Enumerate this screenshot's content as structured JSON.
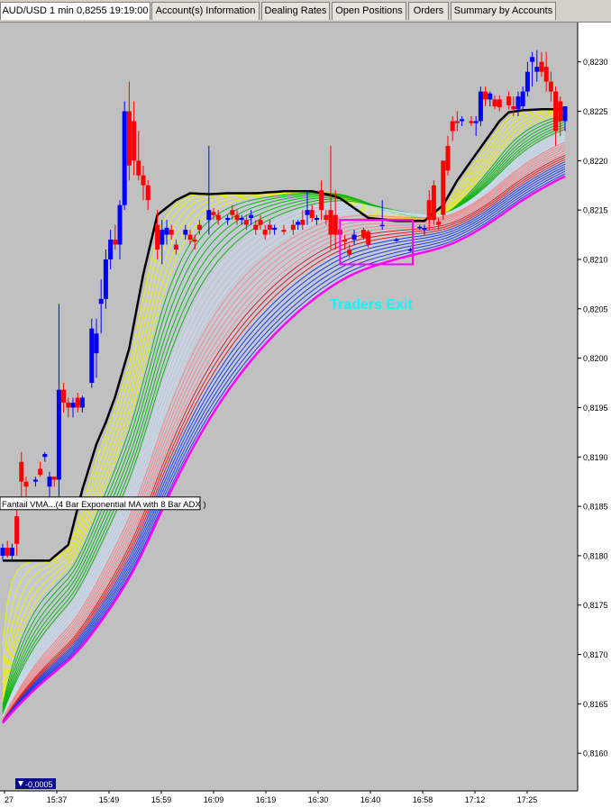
{
  "tabs": [
    {
      "label": "AUD/USD 1 min 0,8255 19:19:00"
    },
    {
      "label": "Account(s) Information"
    },
    {
      "label": "Dealing Rates"
    },
    {
      "label": "Open Positions"
    },
    {
      "label": "Orders"
    },
    {
      "label": "Summary by Accounts"
    }
  ],
  "chart_data": {
    "type": "candlestick",
    "title": "",
    "xlabel": "",
    "ylabel": "",
    "x_tick_labels": [
      "27",
      "15:37",
      "15:49",
      "15:59",
      "16:09",
      "16:19",
      "16:30",
      "16:40",
      "16:58",
      "17:12",
      "17:25"
    ],
    "y_tick_labels": [
      "0,8230",
      "0,8225",
      "0,8220",
      "0,8215",
      "0,8210",
      "0,8205",
      "0,8200",
      "0,8195",
      "0,8190",
      "0,8185",
      "0,8180",
      "0,8175",
      "0,8170",
      "0,8165",
      "0,8160"
    ],
    "ylim": [
      0.81555,
      0.82328
    ],
    "grid": false,
    "indicator_label": "Fantail VMA...(4 Bar Exponential MA with 8 Bar ADX )",
    "annotation_text": "Traders Exit",
    "annotation_color": "#00ffff",
    "cursor_readout": "-0,0005",
    "colors": {
      "up_candle": "#0000ff",
      "down_candle": "#ff0000",
      "vma_line": "#000000",
      "box": "#ff00ff",
      "background": "#c0c0c0"
    },
    "ma_bands": [
      {
        "group": "yellow",
        "color": "#f0f000",
        "lines": 6
      },
      {
        "group": "green",
        "color": "#14b414",
        "lines": 7
      },
      {
        "group": "light-blue",
        "color": "#c8dcf0",
        "lines": 5
      },
      {
        "group": "pink",
        "color": "#f08c8c",
        "lines": 6
      },
      {
        "group": "red",
        "color": "#dc1e1e",
        "lines": 3
      },
      {
        "group": "blue",
        "color": "#1e3cdc",
        "lines": 6
      },
      {
        "group": "magenta",
        "color": "#ff00ff",
        "lines": 1
      }
    ],
    "vma_line": [
      [
        0,
        0.81795
      ],
      [
        10,
        0.81795
      ],
      [
        14,
        0.81811
      ],
      [
        17,
        0.81867
      ],
      [
        20,
        0.81913
      ],
      [
        22,
        0.81935
      ],
      [
        24,
        0.81961
      ],
      [
        27,
        0.8201
      ],
      [
        30,
        0.82085
      ],
      [
        33,
        0.82145
      ],
      [
        37,
        0.8216
      ],
      [
        40,
        0.82167
      ],
      [
        44,
        0.82166
      ],
      [
        48,
        0.82167
      ],
      [
        54,
        0.82167
      ],
      [
        60,
        0.82169
      ],
      [
        66,
        0.82169
      ],
      [
        70,
        0.82165
      ],
      [
        72,
        0.82162
      ],
      [
        78,
        0.82142
      ],
      [
        84,
        0.82139
      ],
      [
        90,
        0.82139
      ],
      [
        92,
        0.82147
      ],
      [
        94,
        0.82155
      ],
      [
        97,
        0.8218
      ],
      [
        100,
        0.822
      ],
      [
        103,
        0.8222
      ],
      [
        106,
        0.8224
      ],
      [
        108,
        0.82249
      ],
      [
        111,
        0.82251
      ],
      [
        115,
        0.82252
      ],
      [
        120,
        0.82252
      ]
    ],
    "candles": [
      {
        "i": 0,
        "o": 0.818,
        "h": 0.81812,
        "l": 0.81795,
        "c": 0.81808
      },
      {
        "i": 1,
        "o": 0.81808,
        "h": 0.81815,
        "l": 0.81798,
        "c": 0.818
      },
      {
        "i": 2,
        "o": 0.818,
        "h": 0.81812,
        "l": 0.81795,
        "c": 0.81808
      },
      {
        "i": 3,
        "o": 0.8184,
        "h": 0.81855,
        "l": 0.818,
        "c": 0.81812
      },
      {
        "i": 4,
        "o": 0.81895,
        "h": 0.81905,
        "l": 0.8186,
        "c": 0.81875
      },
      {
        "i": 5,
        "o": 0.81875,
        "h": 0.8188,
        "l": 0.8186,
        "c": 0.8187
      },
      {
        "i": 7,
        "o": 0.81875,
        "h": 0.8188,
        "l": 0.8187,
        "c": 0.81877
      },
      {
        "i": 8,
        "o": 0.81888,
        "h": 0.81895,
        "l": 0.8188,
        "c": 0.81882
      },
      {
        "i": 9,
        "o": 0.819,
        "h": 0.81905,
        "l": 0.81895,
        "c": 0.81903
      },
      {
        "i": 10,
        "o": 0.8187,
        "h": 0.81885,
        "l": 0.8186,
        "c": 0.8188
      },
      {
        "i": 11,
        "o": 0.8188,
        "h": 0.8188,
        "l": 0.8187,
        "c": 0.81877
      },
      {
        "i": 12,
        "o": 0.81877,
        "h": 0.82055,
        "l": 0.8186,
        "c": 0.81968
      },
      {
        "i": 13,
        "o": 0.81968,
        "h": 0.81975,
        "l": 0.81945,
        "c": 0.81955
      },
      {
        "i": 14,
        "o": 0.81955,
        "h": 0.8196,
        "l": 0.8194,
        "c": 0.8195
      },
      {
        "i": 15,
        "o": 0.8195,
        "h": 0.8196,
        "l": 0.8194,
        "c": 0.81955
      },
      {
        "i": 16,
        "o": 0.8196,
        "h": 0.81965,
        "l": 0.81945,
        "c": 0.8195
      },
      {
        "i": 17,
        "o": 0.8195,
        "h": 0.81962,
        "l": 0.81945,
        "c": 0.8196
      },
      {
        "i": 19,
        "o": 0.81975,
        "h": 0.8204,
        "l": 0.8197,
        "c": 0.8203
      },
      {
        "i": 20,
        "o": 0.82005,
        "h": 0.8204,
        "l": 0.8198,
        "c": 0.82025
      },
      {
        "i": 21,
        "o": 0.82055,
        "h": 0.8208,
        "l": 0.82025,
        "c": 0.8206
      },
      {
        "i": 22,
        "o": 0.8206,
        "h": 0.8211,
        "l": 0.8205,
        "c": 0.821
      },
      {
        "i": 23,
        "o": 0.821,
        "h": 0.8213,
        "l": 0.8209,
        "c": 0.8212
      },
      {
        "i": 24,
        "o": 0.8212,
        "h": 0.82135,
        "l": 0.8211,
        "c": 0.82115
      },
      {
        "i": 25,
        "o": 0.82115,
        "h": 0.8216,
        "l": 0.821,
        "c": 0.82155
      },
      {
        "i": 26,
        "o": 0.82155,
        "h": 0.8226,
        "l": 0.8215,
        "c": 0.8225
      },
      {
        "i": 27,
        "o": 0.8225,
        "h": 0.8228,
        "l": 0.8218,
        "c": 0.82195
      },
      {
        "i": 28,
        "o": 0.8224,
        "h": 0.8226,
        "l": 0.82185,
        "c": 0.822
      },
      {
        "i": 29,
        "o": 0.822,
        "h": 0.8223,
        "l": 0.8218,
        "c": 0.82185
      },
      {
        "i": 30,
        "o": 0.82185,
        "h": 0.82195,
        "l": 0.8216,
        "c": 0.82175
      },
      {
        "i": 31,
        "o": 0.82175,
        "h": 0.8218,
        "l": 0.8215,
        "c": 0.8216
      },
      {
        "i": 33,
        "o": 0.82135,
        "h": 0.8215,
        "l": 0.821,
        "c": 0.8211
      },
      {
        "i": 34,
        "o": 0.82115,
        "h": 0.8214,
        "l": 0.82095,
        "c": 0.8213
      },
      {
        "i": 35,
        "o": 0.82125,
        "h": 0.8214,
        "l": 0.82115,
        "c": 0.82132
      },
      {
        "i": 36,
        "o": 0.8213,
        "h": 0.82135,
        "l": 0.8212,
        "c": 0.82125
      },
      {
        "i": 37,
        "o": 0.82115,
        "h": 0.8212,
        "l": 0.82105,
        "c": 0.8211
      },
      {
        "i": 39,
        "o": 0.82125,
        "h": 0.82135,
        "l": 0.8212,
        "c": 0.8213
      },
      {
        "i": 40,
        "o": 0.82125,
        "h": 0.8213,
        "l": 0.82115,
        "c": 0.8212
      },
      {
        "i": 41,
        "o": 0.8212,
        "h": 0.82125,
        "l": 0.8211,
        "c": 0.82118
      },
      {
        "i": 42,
        "o": 0.82135,
        "h": 0.8214,
        "l": 0.82125,
        "c": 0.8213
      },
      {
        "i": 44,
        "o": 0.8214,
        "h": 0.82215,
        "l": 0.82125,
        "c": 0.8215
      },
      {
        "i": 45,
        "o": 0.82148,
        "h": 0.82152,
        "l": 0.8214,
        "c": 0.82145
      },
      {
        "i": 46,
        "o": 0.82145,
        "h": 0.8215,
        "l": 0.82135,
        "c": 0.8214
      },
      {
        "i": 48,
        "o": 0.8214,
        "h": 0.82145,
        "l": 0.82135,
        "c": 0.82142
      },
      {
        "i": 49,
        "o": 0.8215,
        "h": 0.82155,
        "l": 0.8214,
        "c": 0.82145
      },
      {
        "i": 50,
        "o": 0.82145,
        "h": 0.8215,
        "l": 0.82135,
        "c": 0.8214
      },
      {
        "i": 51,
        "o": 0.8214,
        "h": 0.82145,
        "l": 0.82135,
        "c": 0.82142
      },
      {
        "i": 52,
        "o": 0.8214,
        "h": 0.82145,
        "l": 0.8213,
        "c": 0.82135
      },
      {
        "i": 53,
        "o": 0.82142,
        "h": 0.8215,
        "l": 0.82135,
        "c": 0.82145
      },
      {
        "i": 54,
        "o": 0.82135,
        "h": 0.8214,
        "l": 0.82125,
        "c": 0.8213
      },
      {
        "i": 55,
        "o": 0.8214,
        "h": 0.82145,
        "l": 0.8213,
        "c": 0.82135
      },
      {
        "i": 56,
        "o": 0.8213,
        "h": 0.82135,
        "l": 0.8212,
        "c": 0.82125
      },
      {
        "i": 57,
        "o": 0.82135,
        "h": 0.8214,
        "l": 0.82125,
        "c": 0.8213
      },
      {
        "i": 58,
        "o": 0.8213,
        "h": 0.82135,
        "l": 0.82125,
        "c": 0.82132
      },
      {
        "i": 60,
        "o": 0.8213,
        "h": 0.82135,
        "l": 0.82125,
        "c": 0.82128
      },
      {
        "i": 62,
        "o": 0.82135,
        "h": 0.8214,
        "l": 0.82125,
        "c": 0.8213
      },
      {
        "i": 63,
        "o": 0.82135,
        "h": 0.8214,
        "l": 0.8213,
        "c": 0.82138
      },
      {
        "i": 64,
        "o": 0.8214,
        "h": 0.8215,
        "l": 0.8213,
        "c": 0.82135
      },
      {
        "i": 65,
        "o": 0.82145,
        "h": 0.8217,
        "l": 0.82135,
        "c": 0.8215
      },
      {
        "i": 66,
        "o": 0.8215,
        "h": 0.82155,
        "l": 0.82138,
        "c": 0.82142
      },
      {
        "i": 67,
        "o": 0.8214,
        "h": 0.82145,
        "l": 0.82135,
        "c": 0.82142
      },
      {
        "i": 68,
        "o": 0.8217,
        "h": 0.8218,
        "l": 0.8214,
        "c": 0.8215
      },
      {
        "i": 69,
        "o": 0.82145,
        "h": 0.8215,
        "l": 0.82135,
        "c": 0.8214
      },
      {
        "i": 70,
        "o": 0.8215,
        "h": 0.82215,
        "l": 0.8211,
        "c": 0.82125
      },
      {
        "i": 71,
        "o": 0.82145,
        "h": 0.8217,
        "l": 0.8211,
        "c": 0.82125
      },
      {
        "i": 72,
        "o": 0.8213,
        "h": 0.82135,
        "l": 0.8211,
        "c": 0.82125
      },
      {
        "i": 73,
        "o": 0.8212,
        "h": 0.82125,
        "l": 0.8211,
        "c": 0.82118
      },
      {
        "i": 74,
        "o": 0.8211,
        "h": 0.82115,
        "l": 0.82102,
        "c": 0.82105
      },
      {
        "i": 75,
        "o": 0.8212,
        "h": 0.8213,
        "l": 0.82115,
        "c": 0.82125
      },
      {
        "i": 77,
        "o": 0.8213,
        "h": 0.82132,
        "l": 0.8212,
        "c": 0.82122
      },
      {
        "i": 78,
        "o": 0.82128,
        "h": 0.8213,
        "l": 0.82112,
        "c": 0.82115
      },
      {
        "i": 81,
        "o": 0.82135,
        "h": 0.8216,
        "l": 0.8213,
        "c": 0.82135
      },
      {
        "i": 84,
        "o": 0.8212,
        "h": 0.82122,
        "l": 0.82118,
        "c": 0.8212
      },
      {
        "i": 87,
        "o": 0.8211,
        "h": 0.82112,
        "l": 0.82108,
        "c": 0.8211
      },
      {
        "i": 89,
        "o": 0.82133,
        "h": 0.82135,
        "l": 0.8213,
        "c": 0.82133
      },
      {
        "i": 90,
        "o": 0.8213,
        "h": 0.82135,
        "l": 0.82125,
        "c": 0.82132
      },
      {
        "i": 91,
        "o": 0.8216,
        "h": 0.8217,
        "l": 0.8213,
        "c": 0.8214
      },
      {
        "i": 92,
        "o": 0.82175,
        "h": 0.8218,
        "l": 0.82135,
        "c": 0.8214
      },
      {
        "i": 93,
        "o": 0.82138,
        "h": 0.82142,
        "l": 0.8213,
        "c": 0.82135
      },
      {
        "i": 94,
        "o": 0.822,
        "h": 0.822,
        "l": 0.8214,
        "c": 0.82145
      },
      {
        "i": 95,
        "o": 0.82215,
        "h": 0.82225,
        "l": 0.82185,
        "c": 0.8219
      },
      {
        "i": 96,
        "o": 0.8224,
        "h": 0.82245,
        "l": 0.8222,
        "c": 0.8223
      },
      {
        "i": 97,
        "o": 0.8224,
        "h": 0.8225,
        "l": 0.8223,
        "c": 0.82238
      },
      {
        "i": 98,
        "o": 0.8224,
        "h": 0.82245,
        "l": 0.82235,
        "c": 0.82242
      },
      {
        "i": 100,
        "o": 0.8224,
        "h": 0.82245,
        "l": 0.82235,
        "c": 0.82238
      },
      {
        "i": 101,
        "o": 0.82238,
        "h": 0.82245,
        "l": 0.82225,
        "c": 0.8224
      },
      {
        "i": 102,
        "o": 0.8224,
        "h": 0.82275,
        "l": 0.82235,
        "c": 0.8227
      },
      {
        "i": 103,
        "o": 0.8227,
        "h": 0.82275,
        "l": 0.82255,
        "c": 0.82262
      },
      {
        "i": 104,
        "o": 0.82262,
        "h": 0.8227,
        "l": 0.82255,
        "c": 0.82268
      },
      {
        "i": 105,
        "o": 0.82262,
        "h": 0.82266,
        "l": 0.82252,
        "c": 0.82255
      },
      {
        "i": 106,
        "o": 0.82262,
        "h": 0.82266,
        "l": 0.8225,
        "c": 0.82254
      },
      {
        "i": 108,
        "o": 0.82265,
        "h": 0.8227,
        "l": 0.82252,
        "c": 0.82256
      },
      {
        "i": 109,
        "o": 0.82255,
        "h": 0.82265,
        "l": 0.82245,
        "c": 0.82252
      },
      {
        "i": 110,
        "o": 0.82252,
        "h": 0.8227,
        "l": 0.82245,
        "c": 0.82265
      },
      {
        "i": 111,
        "o": 0.82255,
        "h": 0.82275,
        "l": 0.8225,
        "c": 0.8227
      },
      {
        "i": 112,
        "o": 0.8227,
        "h": 0.823,
        "l": 0.82265,
        "c": 0.8229
      },
      {
        "i": 113,
        "o": 0.823,
        "h": 0.8231,
        "l": 0.82275,
        "c": 0.82305
      },
      {
        "i": 114,
        "o": 0.8229,
        "h": 0.82312,
        "l": 0.8228,
        "c": 0.82295
      },
      {
        "i": 115,
        "o": 0.823,
        "h": 0.8231,
        "l": 0.82285,
        "c": 0.8229
      },
      {
        "i": 116,
        "o": 0.82295,
        "h": 0.8231,
        "l": 0.8227,
        "c": 0.8228
      },
      {
        "i": 117,
        "o": 0.8228,
        "h": 0.8229,
        "l": 0.8226,
        "c": 0.8227
      },
      {
        "i": 118,
        "o": 0.8227,
        "h": 0.82275,
        "l": 0.82215,
        "c": 0.8223
      },
      {
        "i": 119,
        "o": 0.8226,
        "h": 0.82265,
        "l": 0.82225,
        "c": 0.8224
      },
      {
        "i": 120,
        "o": 0.8224,
        "h": 0.82255,
        "l": 0.8223,
        "c": 0.82255
      }
    ]
  }
}
